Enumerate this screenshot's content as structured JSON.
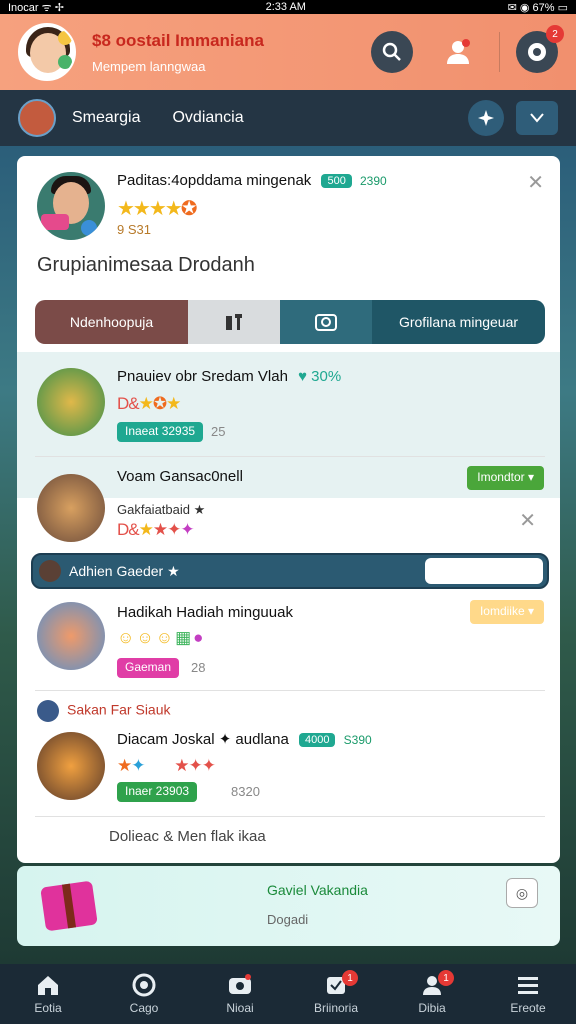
{
  "status": {
    "left": "Inocar ᯤ ✢",
    "time": "2:33 AM",
    "right": "✉ ◉ 67% ▭"
  },
  "header": {
    "title": "$8 oostail Immaniana",
    "subtitle": "Mempem lanngwaa",
    "message_badge": "2",
    "colors": {
      "bg": "#f39a78",
      "title": "#c8281e"
    }
  },
  "nav": {
    "label1": "Smeargia",
    "label2": "Ovdiancia"
  },
  "profile": {
    "title": "Paditas:4opddama mingenak",
    "pill": "500",
    "pill_extra": "2390",
    "score": "9 S31",
    "headline": "Grupianimesaa Drodanh"
  },
  "segments": {
    "tab1": "Ndenhoopuja",
    "tab4": "Grofilana mingeuar"
  },
  "items": [
    {
      "title": "Pnauiev obr Sredam Vlah",
      "tag": "♥ 30%",
      "chip": "Inaeat 32935",
      "chip_num": "25",
      "stars_prefix": "D&"
    },
    {
      "title": "Voam Gansac0nell",
      "button": "Imondtor ▾",
      "sub": "Gakfaiatbaid ★",
      "stars_prefix": "D&"
    }
  ],
  "bluebar": {
    "label": "Adhien Gaeder ★"
  },
  "item3": {
    "title": "Hadikah Hadiah minguuak",
    "button": "Iomdiike ▾",
    "chip": "Gaeman",
    "chip_num": "28"
  },
  "section": {
    "heading": "Sakan Far Siauk"
  },
  "item4": {
    "title": "Diacam Joskal ✦ audlana",
    "pill": "4000",
    "pill_extra": "S390",
    "chip": "Inaer 23903",
    "chip_num": "8320"
  },
  "footer_line": "Dolieac & Men flak ikaa",
  "promo": {
    "title": "Gaviel Vakandia",
    "sub": "Dogadi",
    "btn": "◎"
  },
  "bottom_nav": [
    {
      "label": "Eotia",
      "icon": "home-icon"
    },
    {
      "label": "Cago",
      "icon": "game-icon"
    },
    {
      "label": "Nioai",
      "icon": "camera-icon"
    },
    {
      "label": "Briinoria",
      "icon": "badge-icon",
      "badge": "1"
    },
    {
      "label": "Dibia",
      "icon": "user-icon",
      "badge": "1"
    },
    {
      "label": "Ereote",
      "icon": "menu-icon"
    }
  ]
}
